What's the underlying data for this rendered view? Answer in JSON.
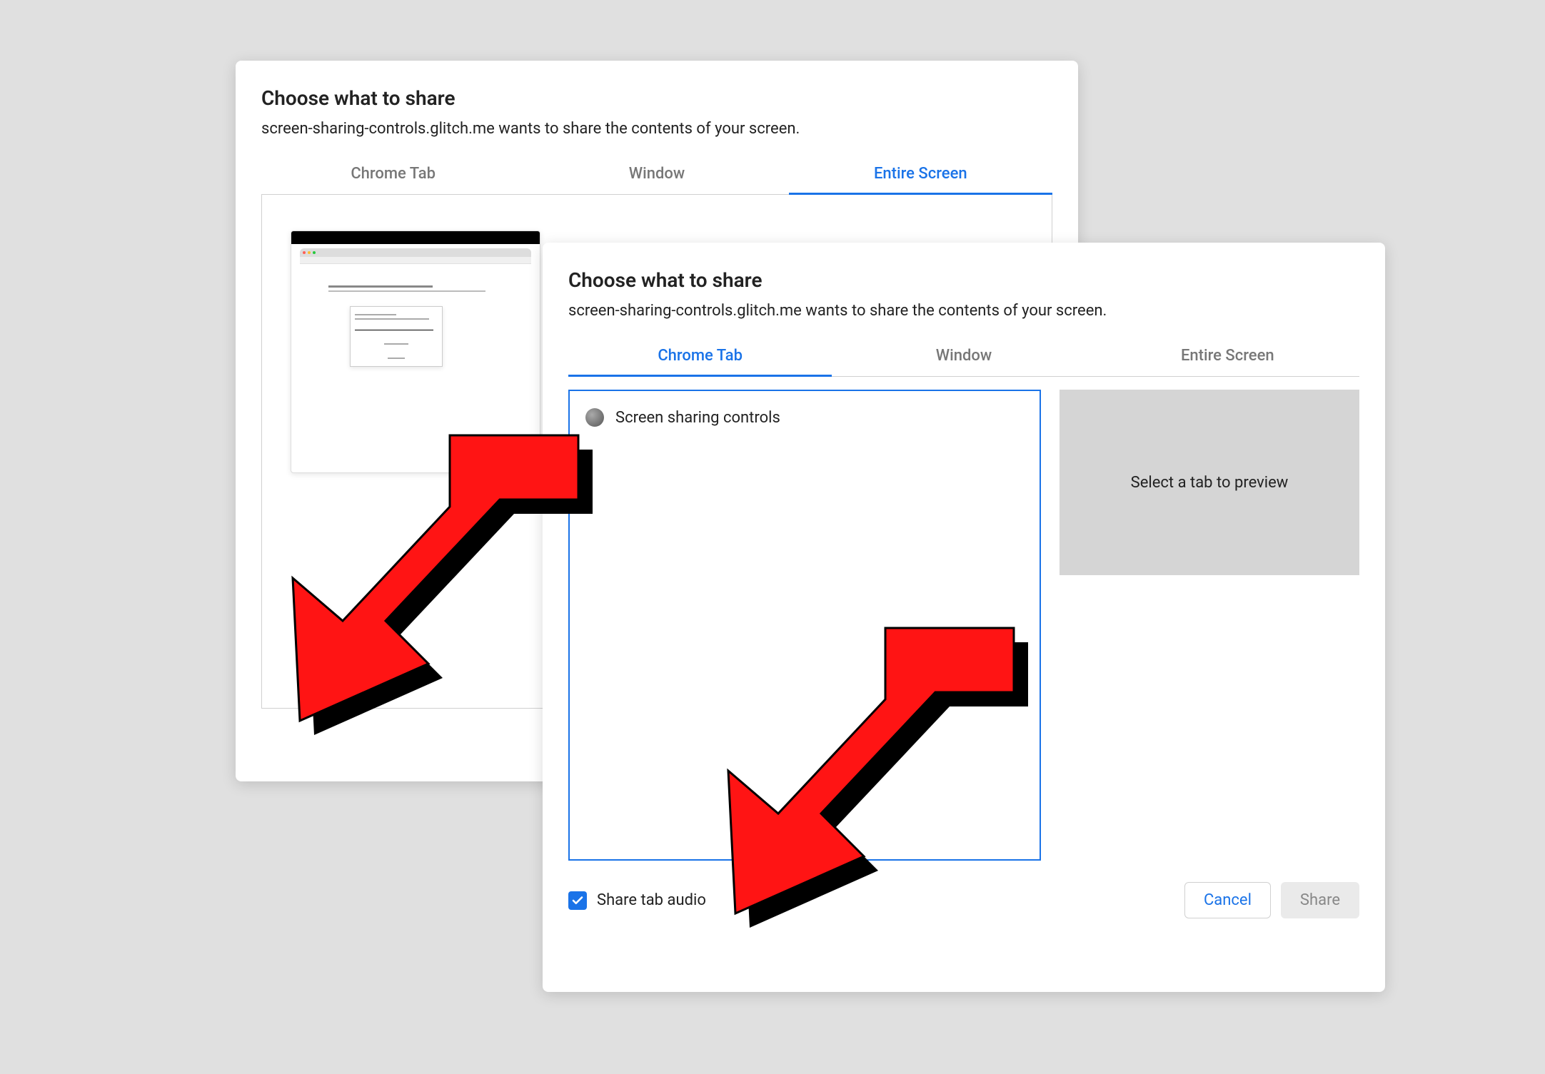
{
  "dialogBack": {
    "title": "Choose what to share",
    "subtitle": "screen-sharing-controls.glitch.me wants to share the contents of your screen.",
    "tabs": [
      {
        "label": "Chrome Tab",
        "active": false
      },
      {
        "label": "Window",
        "active": false
      },
      {
        "label": "Entire Screen",
        "active": true
      }
    ]
  },
  "dialogFront": {
    "title": "Choose what to share",
    "subtitle": "screen-sharing-controls.glitch.me wants to share the contents of your screen.",
    "tabs": [
      {
        "label": "Chrome Tab",
        "active": true
      },
      {
        "label": "Window",
        "active": false
      },
      {
        "label": "Entire Screen",
        "active": false
      }
    ],
    "tabItems": [
      {
        "label": "Screen sharing controls"
      }
    ],
    "previewPlaceholder": "Select a tab to preview",
    "shareAudio": {
      "label": "Share tab audio",
      "checked": true
    },
    "buttons": {
      "cancel": "Cancel",
      "share": "Share"
    }
  },
  "colors": {
    "accent": "#1a73e8",
    "arrow": "#ff0000"
  }
}
